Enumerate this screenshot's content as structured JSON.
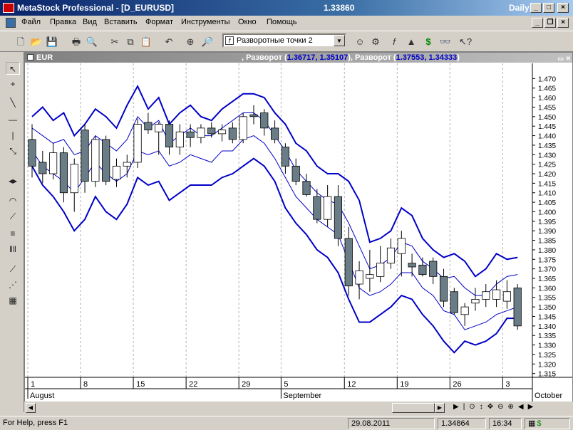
{
  "window": {
    "title": "MetaStock Professional - [D_EURUSD]",
    "price": "1.33860",
    "period": "Daily"
  },
  "menu": [
    "Файл",
    "Правка",
    "Вид",
    "Вставить",
    "Формат",
    "Инструменты",
    "Окно",
    "Помощь"
  ],
  "toolbar": {
    "template_combo": "Разворотные точки 2"
  },
  "chart_header": {
    "symbol": "EUR",
    "ind1_label": ", Разворот (",
    "ind1_values": "1.36717, 1.35107",
    "ind2_label": "), Разворот (",
    "ind2_values": "1.37553, 1.34333",
    "close": ")"
  },
  "colors": {
    "bull": "#ffffff",
    "bear": "#6a7d86",
    "band": "#0000c8",
    "grid": "#b0b0b0"
  },
  "chart_data": {
    "type": "candlestick",
    "ylim": [
      1.313,
      1.478
    ],
    "y_ticks": [
      "1.470",
      "1.465",
      "1.460",
      "1.455",
      "1.450",
      "1.445",
      "1.440",
      "1.435",
      "1.430",
      "1.425",
      "1.420",
      "1.415",
      "1.410",
      "1.405",
      "1.400",
      "1.395",
      "1.390",
      "1.385",
      "1.380",
      "1.375",
      "1.370",
      "1.365",
      "1.360",
      "1.355",
      "1.350",
      "1.345",
      "1.340",
      "1.335",
      "1.330",
      "1.325",
      "1.320",
      "1.315"
    ],
    "x_day_labels": [
      "1",
      "8",
      "15",
      "22",
      "29",
      "5",
      "12",
      "19",
      "26",
      "3"
    ],
    "x_month_labels": [
      "August",
      "September",
      "October"
    ],
    "candles": [
      {
        "o": 1.438,
        "h": 1.446,
        "l": 1.418,
        "c": 1.424
      },
      {
        "o": 1.426,
        "h": 1.432,
        "l": 1.415,
        "c": 1.42
      },
      {
        "o": 1.42,
        "h": 1.436,
        "l": 1.417,
        "c": 1.431
      },
      {
        "o": 1.431,
        "h": 1.434,
        "l": 1.405,
        "c": 1.41
      },
      {
        "o": 1.41,
        "h": 1.428,
        "l": 1.4,
        "c": 1.425
      },
      {
        "o": 1.443,
        "h": 1.446,
        "l": 1.41,
        "c": 1.416
      },
      {
        "o": 1.416,
        "h": 1.44,
        "l": 1.413,
        "c": 1.438
      },
      {
        "o": 1.438,
        "h": 1.44,
        "l": 1.414,
        "c": 1.416
      },
      {
        "o": 1.417,
        "h": 1.428,
        "l": 1.413,
        "c": 1.424
      },
      {
        "o": 1.424,
        "h": 1.43,
        "l": 1.418,
        "c": 1.426
      },
      {
        "o": 1.426,
        "h": 1.449,
        "l": 1.423,
        "c": 1.446
      },
      {
        "o": 1.447,
        "h": 1.452,
        "l": 1.441,
        "c": 1.443
      },
      {
        "o": 1.442,
        "h": 1.447,
        "l": 1.43,
        "c": 1.446
      },
      {
        "o": 1.446,
        "h": 1.448,
        "l": 1.43,
        "c": 1.434
      },
      {
        "o": 1.434,
        "h": 1.446,
        "l": 1.43,
        "c": 1.442
      },
      {
        "o": 1.442,
        "h": 1.446,
        "l": 1.434,
        "c": 1.439
      },
      {
        "o": 1.439,
        "h": 1.446,
        "l": 1.436,
        "c": 1.444
      },
      {
        "o": 1.444,
        "h": 1.447,
        "l": 1.439,
        "c": 1.441
      },
      {
        "o": 1.441,
        "h": 1.446,
        "l": 1.437,
        "c": 1.443
      },
      {
        "o": 1.444,
        "h": 1.447,
        "l": 1.436,
        "c": 1.438
      },
      {
        "o": 1.438,
        "h": 1.452,
        "l": 1.436,
        "c": 1.45
      },
      {
        "o": 1.451,
        "h": 1.456,
        "l": 1.446,
        "c": 1.45
      },
      {
        "o": 1.452,
        "h": 1.454,
        "l": 1.44,
        "c": 1.444
      },
      {
        "o": 1.444,
        "h": 1.448,
        "l": 1.436,
        "c": 1.438
      },
      {
        "o": 1.434,
        "h": 1.436,
        "l": 1.42,
        "c": 1.424
      },
      {
        "o": 1.424,
        "h": 1.428,
        "l": 1.414,
        "c": 1.416
      },
      {
        "o": 1.416,
        "h": 1.42,
        "l": 1.408,
        "c": 1.409
      },
      {
        "o": 1.408,
        "h": 1.412,
        "l": 1.394,
        "c": 1.396
      },
      {
        "o": 1.396,
        "h": 1.414,
        "l": 1.392,
        "c": 1.408
      },
      {
        "o": 1.408,
        "h": 1.414,
        "l": 1.382,
        "c": 1.386
      },
      {
        "o": 1.386,
        "h": 1.392,
        "l": 1.356,
        "c": 1.361
      },
      {
        "o": 1.362,
        "h": 1.374,
        "l": 1.354,
        "c": 1.369
      },
      {
        "o": 1.365,
        "h": 1.38,
        "l": 1.358,
        "c": 1.367
      },
      {
        "o": 1.366,
        "h": 1.382,
        "l": 1.363,
        "c": 1.373
      },
      {
        "o": 1.373,
        "h": 1.386,
        "l": 1.37,
        "c": 1.381
      },
      {
        "o": 1.378,
        "h": 1.39,
        "l": 1.366,
        "c": 1.386
      },
      {
        "o": 1.373,
        "h": 1.378,
        "l": 1.366,
        "c": 1.371
      },
      {
        "o": 1.372,
        "h": 1.376,
        "l": 1.366,
        "c": 1.367
      },
      {
        "o": 1.374,
        "h": 1.376,
        "l": 1.362,
        "c": 1.366
      },
      {
        "o": 1.366,
        "h": 1.37,
        "l": 1.35,
        "c": 1.353
      },
      {
        "o": 1.358,
        "h": 1.36,
        "l": 1.346,
        "c": 1.347
      },
      {
        "o": 1.346,
        "h": 1.352,
        "l": 1.34,
        "c": 1.35
      },
      {
        "o": 1.352,
        "h": 1.36,
        "l": 1.348,
        "c": 1.354
      },
      {
        "o": 1.354,
        "h": 1.362,
        "l": 1.35,
        "c": 1.358
      },
      {
        "o": 1.354,
        "h": 1.364,
        "l": 1.35,
        "c": 1.359
      },
      {
        "o": 1.353,
        "h": 1.364,
        "l": 1.349,
        "c": 1.358
      },
      {
        "o": 1.36,
        "h": 1.362,
        "l": 1.338,
        "c": 1.34
      }
    ],
    "upper_outer": [
      1.45,
      1.455,
      1.448,
      1.452,
      1.44,
      1.446,
      1.454,
      1.45,
      1.444,
      1.456,
      1.466,
      1.454,
      1.46,
      1.446,
      1.452,
      1.456,
      1.45,
      1.448,
      1.454,
      1.458,
      1.462,
      1.462,
      1.46,
      1.452,
      1.446,
      1.436,
      1.432,
      1.424,
      1.42,
      1.42,
      1.416,
      1.406,
      1.384,
      1.386,
      1.39,
      1.402,
      1.398,
      1.386,
      1.38,
      1.376,
      1.378,
      1.374,
      1.366,
      1.37,
      1.378,
      1.375,
      1.376
    ],
    "upper_inner": [
      1.444,
      1.44,
      1.436,
      1.438,
      1.43,
      1.432,
      1.44,
      1.436,
      1.432,
      1.438,
      1.45,
      1.444,
      1.448,
      1.436,
      1.44,
      1.444,
      1.44,
      1.44,
      1.444,
      1.448,
      1.452,
      1.452,
      1.448,
      1.44,
      1.432,
      1.422,
      1.416,
      1.41,
      1.406,
      1.404,
      1.394,
      1.382,
      1.37,
      1.372,
      1.376,
      1.384,
      1.382,
      1.374,
      1.37,
      1.365,
      1.366,
      1.36,
      1.356,
      1.356,
      1.362,
      1.366,
      1.367
    ],
    "lower_inner": [
      1.432,
      1.424,
      1.42,
      1.416,
      1.41,
      1.418,
      1.426,
      1.42,
      1.416,
      1.42,
      1.432,
      1.43,
      1.432,
      1.424,
      1.426,
      1.43,
      1.428,
      1.426,
      1.432,
      1.432,
      1.438,
      1.44,
      1.436,
      1.428,
      1.418,
      1.408,
      1.402,
      1.396,
      1.392,
      1.388,
      1.374,
      1.36,
      1.356,
      1.358,
      1.362,
      1.368,
      1.368,
      1.36,
      1.356,
      1.348,
      1.346,
      1.338,
      1.34,
      1.342,
      1.346,
      1.348,
      1.35
    ],
    "lower_outer": [
      1.424,
      1.414,
      1.408,
      1.4,
      1.39,
      1.396,
      1.408,
      1.4,
      1.396,
      1.404,
      1.418,
      1.414,
      1.416,
      1.406,
      1.41,
      1.414,
      1.414,
      1.414,
      1.418,
      1.42,
      1.424,
      1.428,
      1.424,
      1.416,
      1.402,
      1.394,
      1.388,
      1.38,
      1.376,
      1.368,
      1.354,
      1.342,
      1.342,
      1.346,
      1.35,
      1.356,
      1.354,
      1.346,
      1.34,
      1.332,
      1.326,
      1.332,
      1.33,
      1.332,
      1.336,
      1.344,
      1.344
    ]
  },
  "status": {
    "help": "For Help, press F1",
    "date": "29.08.2011",
    "value": "1.34864",
    "time": "16:34"
  }
}
